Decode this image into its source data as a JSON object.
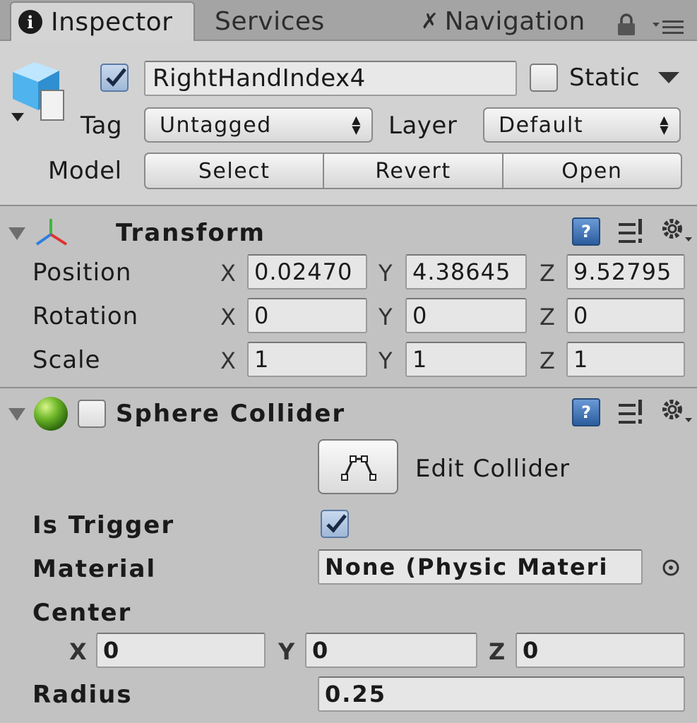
{
  "tabs": [
    {
      "label": "Inspector",
      "icon": "info-icon"
    },
    {
      "label": "Services"
    },
    {
      "label": "Navigation",
      "icon": "navigation-icon"
    }
  ],
  "object": {
    "active": true,
    "name": "RightHandIndex4",
    "static_label": "Static",
    "static_checked": false,
    "tag_label": "Tag",
    "tag_value": "Untagged",
    "layer_label": "Layer",
    "layer_value": "Default",
    "model_label": "Model",
    "model_buttons": [
      "Select",
      "Revert",
      "Open"
    ]
  },
  "transform": {
    "title": "Transform",
    "rows": [
      {
        "label": "Position",
        "x": "0.02470",
        "y": "4.38645",
        "z": "9.52795"
      },
      {
        "label": "Rotation",
        "x": "0",
        "y": "0",
        "z": "0"
      },
      {
        "label": "Scale",
        "x": "1",
        "y": "1",
        "z": "1"
      }
    ],
    "axes": [
      "X",
      "Y",
      "Z"
    ]
  },
  "sphere_collider": {
    "title": "Sphere Collider",
    "enabled": false,
    "edit_collider_label": "Edit Collider",
    "is_trigger_label": "Is Trigger",
    "is_trigger": true,
    "material_label": "Material",
    "material_value": "None (Physic Materi",
    "center_label": "Center",
    "center": {
      "x": "0",
      "y": "0",
      "z": "0"
    },
    "radius_label": "Radius",
    "radius": "0.25"
  },
  "colors": {
    "tabbar": "#a4a4a4",
    "panel": "#c2c2c2",
    "header": "#d2d2d2",
    "checkbox_checked": "#9fb8d8"
  }
}
